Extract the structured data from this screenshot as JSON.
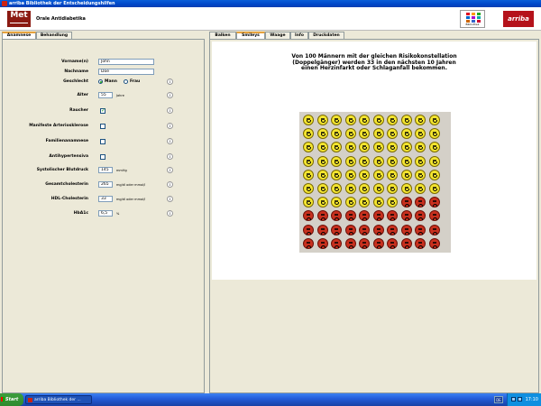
{
  "window": {
    "title": "arriba Bibliothek der Entscheidungshilfen"
  },
  "header": {
    "logo_text": "Met",
    "subject": "Orale Antidiabetika",
    "library_label": "Bibliothek",
    "brand": "arriba"
  },
  "left_tabs": [
    {
      "label": "Anamnese",
      "active": true
    },
    {
      "label": "Behandlung",
      "active": false
    }
  ],
  "right_tabs": [
    {
      "label": "Balken",
      "active": false
    },
    {
      "label": "Smileys",
      "active": true
    },
    {
      "label": "Waage",
      "active": false
    },
    {
      "label": "Info",
      "active": false
    },
    {
      "label": "Druckdaten",
      "active": false
    }
  ],
  "form": {
    "vorname": {
      "label": "Vorname(n)",
      "value": "John"
    },
    "nachname": {
      "label": "Nachname",
      "value": "Doe"
    },
    "geschlecht": {
      "label": "Geschlecht",
      "option_male": "Mann",
      "option_female": "Frau",
      "selected": "Mann"
    },
    "alter": {
      "label": "Alter",
      "value": "55",
      "unit": "Jahre"
    },
    "raucher": {
      "label": "Raucher",
      "checked": true
    },
    "arteriosklerose": {
      "label": "Manifeste Arteriosklerose",
      "checked": false
    },
    "familienanamnese": {
      "label": "Familienanamnese",
      "checked": false
    },
    "antihypertensiva": {
      "label": "Antihypertensiva",
      "checked": false
    },
    "blutdruck": {
      "label": "Systolischer Blutdruck",
      "value": "145",
      "unit": "mmHg"
    },
    "cholesterin": {
      "label": "Gesamtcholesterin",
      "value": "265",
      "unit": "mg/dl oder mmol/l"
    },
    "hdl": {
      "label": "HDL-Cholesterin",
      "value": "33",
      "unit": "mg/dl oder mmol/l"
    },
    "hba1c": {
      "label": "HbA1c",
      "value": "6,5",
      "unit": "%"
    }
  },
  "smileys": {
    "headline_1": "Von 100 Männern mit der gleichen Risikokonstellation",
    "headline_2": "(Doppelgänger) werden 33 in den nächsten 10 Jahren",
    "headline_3": "einen Herzinfarkt oder Schlaganfall bekommen.",
    "total": 100,
    "affected": 33,
    "columns": 10,
    "good_color": "#f4e530",
    "bad_color": "#c8301e"
  },
  "taskbar": {
    "start_label": "Start",
    "task_label": "arriba Bibliothek der ...",
    "language": "DE",
    "clock": "17:10"
  },
  "icons": {
    "info": "i"
  }
}
